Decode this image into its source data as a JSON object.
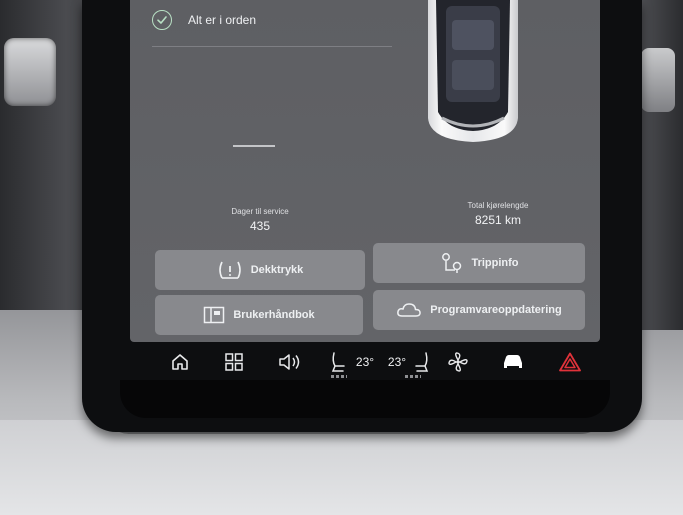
{
  "status": {
    "text": "Alt er i orden",
    "icon": "check-circle-icon"
  },
  "service": {
    "label": "Dager til service",
    "value": "435"
  },
  "mileage": {
    "label": "Total kjørelengde",
    "value": "8251 km"
  },
  "buttons": {
    "tyre_pressure": "Dekktrykk",
    "trip_info": "Trippinfo",
    "owners_manual": "Brukerhåndbok",
    "software_update": "Programvareoppdatering"
  },
  "toolbar": {
    "temp_driver": "23°",
    "temp_passenger": "23°",
    "icons": [
      "home-icon",
      "apps-grid-icon",
      "volume-icon",
      "seat-heat-left-icon",
      "seat-heat-right-icon",
      "fan-icon",
      "car-icon",
      "hazard-icon"
    ]
  },
  "colors": {
    "screen_bg": "#5f6064",
    "button_bg": "#88898d",
    "check_green": "#b8e0c4",
    "hazard_red": "#e0323a",
    "car_active": "#ffffff"
  }
}
